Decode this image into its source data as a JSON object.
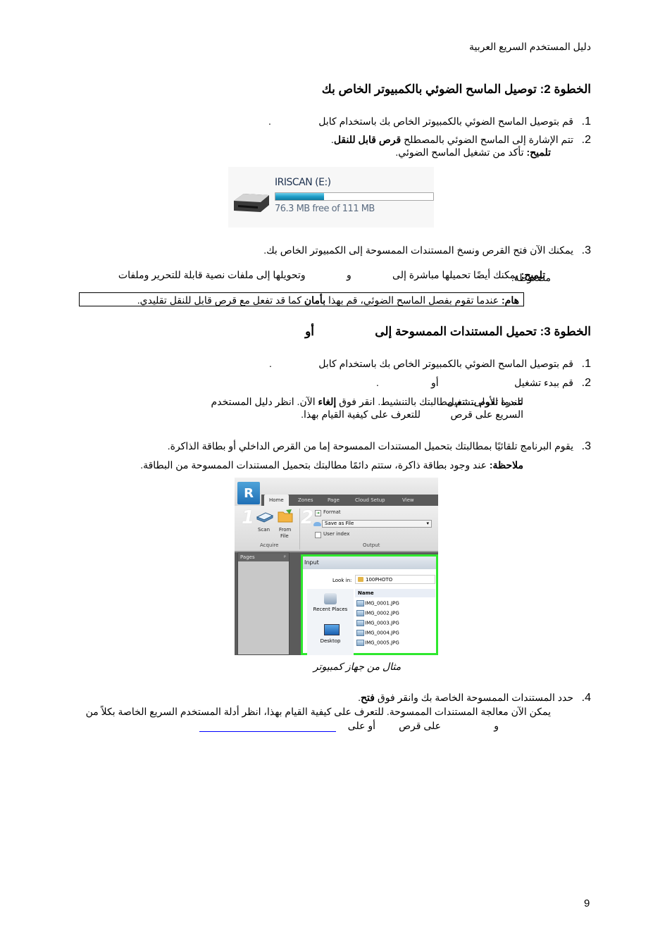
{
  "header": {
    "title": "دليل المستخدم السريع   العربية"
  },
  "step2": {
    "heading": "الخطوة 2: توصيل الماسح الضوئي بالكمبيوتر الخاص بك",
    "items": [
      {
        "num": "1.",
        "text": "قم بتوصيل الماسح الضوئي بالكمبيوتر الخاص بك باستخدام كابل",
        "trail": "."
      },
      {
        "num": "2.",
        "text_before": "تتم الإشارة إلى الماسح الضوئي بالمصطلح ",
        "bold": "قرص قابل للنقل",
        "text_after": ".",
        "tip_label": "تلميح:",
        "tip_text": " تأكد من تشغيل الماسح الضوئي."
      },
      {
        "num": "3.",
        "text": "يمكنك الآن فتح القرص ونسخ المستندات الممسوحة إلى الكمبيوتر الخاص بك.",
        "tip_label": "تلميح:",
        "tip_line1": " يمكنك أيضًا تحميلها مباشرة إلى               و               وتحويلها إلى ملفات نصية قابلة للتحرير وملفات",
        "tip_line2": "مضغوطة."
      }
    ],
    "drive": {
      "name": "IRISCAN (E:)",
      "free_text": "76.3 MB free of 111 MB",
      "used_fraction": 0.31,
      "icon": "removable-drive-icon"
    },
    "important": {
      "label": "هام:",
      "text_before": " عندما تقوم بفصل الماسح الضوئي، قم بهذا ",
      "bold": "بأمان",
      "text_after": " كما قد تفعل مع قرص قابل للنقل تقليدي."
    }
  },
  "step3": {
    "heading_main": "الخطوة 3: تحميل المستندات الممسوحة إلى",
    "heading_or": "أو",
    "items": [
      {
        "num": "1.",
        "text": "قم بتوصيل الماسح الضوئي بالكمبيوتر الخاص بك باستخدام كابل",
        "trail": "."
      },
      {
        "num": "2.",
        "text": "قم ببدء تشغيل",
        "or": "أو",
        "trail": "."
      },
      {
        "num": "3.",
        "text": "يقوم البرنامج تلقائيًا بمطالبتك بتحميل المستندات الممسوحة إما من القرص الداخلي أو بطاقة الذاكرة."
      },
      {
        "num": "4.",
        "text_before": "حدد المستندات الممسوحة الخاصة بك وانقر فوق ",
        "bold": "فتح",
        "text_after": ".",
        "line2": "يمكن الآن معالجة المستندات الممسوحة. للتعرف على كيفية القيام بهذا، انظر أدلة المستخدم السريع الخاصة بكلاً من",
        "line3_a": "و",
        "line3_b": "على قرص",
        "line3_c": "أو على"
      }
    ],
    "activation_note": {
      "line1_a": "عندما تقوم بتشغيل",
      "line1_b": "للمرة الأولى، تتم مطالبتك بالتنشيط. انقر فوق ",
      "line1_bold": "إلغاء",
      "line1_c": " الآن. انظر دليل المستخدم",
      "line2_a": "السريع على قرص",
      "line2_b": "للتعرف على كيفية القيام بهذا."
    },
    "note": {
      "label": "ملاحظة:",
      "text": " عند وجود بطاقة ذاكرة، ستتم دائمًا مطالبتك بتحميل المستندات الممسوحة من البطاقة."
    },
    "caption": "مثال من جهاز كمبيوتر"
  },
  "app": {
    "logo": "R",
    "tabs": [
      "Home",
      "Zones",
      "Page",
      "Cloud Setup",
      "View"
    ],
    "acquire": {
      "step": "1",
      "scan": "Scan",
      "from_file_1": "From",
      "from_file_2": "File",
      "group": "Acquire"
    },
    "output": {
      "step": "2",
      "format": "Format",
      "save_as": "Save as File",
      "user_index": "User index",
      "group": "Output"
    },
    "pages_panel": "Pages",
    "dialog": {
      "title": "Input",
      "look_in_label": "Look in:",
      "look_in_value": "100PHOTO",
      "places": [
        "Recent Places",
        "Desktop"
      ],
      "column": "Name",
      "files": [
        "IMG_0001.JPG",
        "IMG_0002.JPG",
        "IMG_0003.JPG",
        "IMG_0004.JPG",
        "IMG_0005.JPG"
      ]
    }
  },
  "footer": {
    "page_number": "9"
  }
}
